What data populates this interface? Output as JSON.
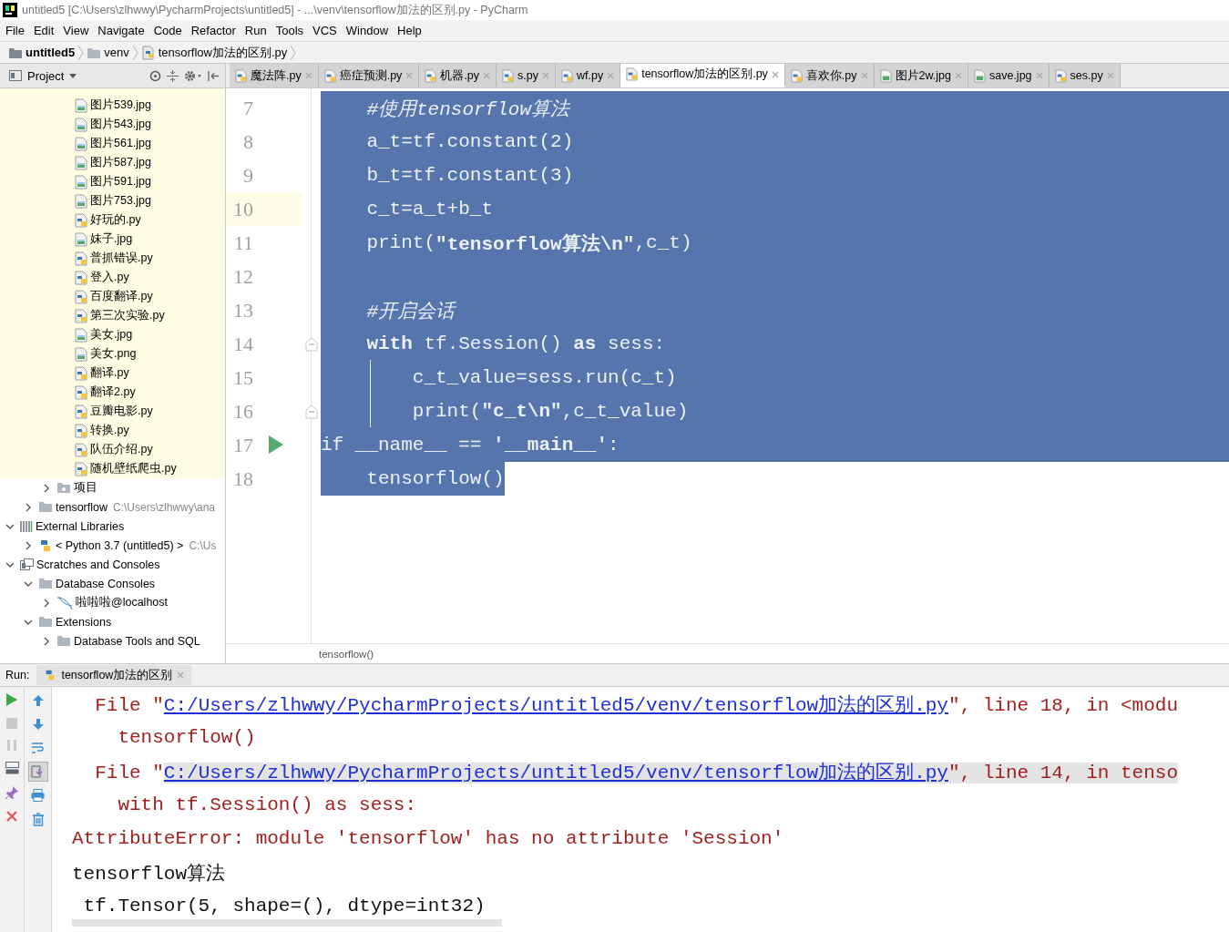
{
  "window": {
    "title": "untitled5 [C:\\Users\\zlhwwy\\PycharmProjects\\untitled5] - ...\\venv\\tensorflow加法的区别.py - PyCharm"
  },
  "menu": [
    "File",
    "Edit",
    "View",
    "Navigate",
    "Code",
    "Refactor",
    "Run",
    "Tools",
    "VCS",
    "Window",
    "Help"
  ],
  "breadcrumbs": [
    {
      "label": "untitled5",
      "kind": "project"
    },
    {
      "label": "venv",
      "kind": "folder"
    },
    {
      "label": "tensorflow加法的区别.py",
      "kind": "python"
    }
  ],
  "project_panel": {
    "title": "Project",
    "tree": [
      {
        "children": [
          {
            "children": [
              {
                "children": [
                  {
                    "label": "图片539.jpg",
                    "kind": "image"
                  },
                  {
                    "label": "图片543.jpg",
                    "kind": "image"
                  },
                  {
                    "label": "图片561.jpg",
                    "kind": "image"
                  },
                  {
                    "label": "图片587.jpg",
                    "kind": "image"
                  },
                  {
                    "label": "图片591.jpg",
                    "kind": "image"
                  },
                  {
                    "label": "图片753.jpg",
                    "kind": "image"
                  },
                  {
                    "label": "好玩的.py",
                    "kind": "python"
                  },
                  {
                    "label": "妹子.jpg",
                    "kind": "image"
                  },
                  {
                    "label": "普抓错误.py",
                    "kind": "python"
                  },
                  {
                    "label": "登入.py",
                    "kind": "python"
                  },
                  {
                    "label": "百度翻译.py",
                    "kind": "python"
                  },
                  {
                    "label": "第三次实验.py",
                    "kind": "python"
                  },
                  {
                    "label": "美女.jpg",
                    "kind": "image"
                  },
                  {
                    "label": "美女.png",
                    "kind": "image"
                  },
                  {
                    "label": "翻译.py",
                    "kind": "python"
                  },
                  {
                    "label": "翻译2.py",
                    "kind": "python"
                  },
                  {
                    "label": "豆瓣电影.py",
                    "kind": "python"
                  },
                  {
                    "label": "转换.py",
                    "kind": "python"
                  },
                  {
                    "label": "队伍介绍.py",
                    "kind": "python"
                  },
                  {
                    "label": "随机壁纸爬虫.py",
                    "kind": "python"
                  }
                ]
              },
              {
                "label": "项目",
                "kind": "package",
                "expanded": false
              }
            ]
          },
          {
            "label": "tensorflow",
            "detail": "C:\\Users\\zlhwwy\\ana",
            "kind": "folder",
            "expanded": false
          }
        ]
      },
      {
        "label": "External Libraries",
        "kind": "library",
        "expanded": true,
        "children": [
          {
            "label": "< Python 3.7 (untitled5) >",
            "detail": "C:\\Us",
            "kind": "sdk",
            "expanded": false
          }
        ]
      },
      {
        "label": "Scratches and Consoles",
        "kind": "scratches",
        "expanded": true,
        "children": [
          {
            "label": "Database Consoles",
            "kind": "folder",
            "expanded": true,
            "children": [
              {
                "label": "啦啦啦@localhost",
                "kind": "database",
                "expanded": false
              }
            ]
          },
          {
            "label": "Extensions",
            "kind": "folder",
            "expanded": true,
            "children": [
              {
                "label": "Database Tools and SQL",
                "kind": "folder",
                "expanded": false
              }
            ]
          }
        ]
      }
    ]
  },
  "editor_tabs": [
    {
      "label": "魔法阵.py",
      "kind": "python",
      "selected": false
    },
    {
      "label": "癌症预测.py",
      "kind": "python",
      "selected": false
    },
    {
      "label": "机器.py",
      "kind": "python",
      "selected": false
    },
    {
      "label": "s.py",
      "kind": "python",
      "selected": false
    },
    {
      "label": "wf.py",
      "kind": "python",
      "selected": false
    },
    {
      "label": "tensorflow加法的区别.py",
      "kind": "python",
      "selected": true
    },
    {
      "label": "喜欢你.py",
      "kind": "python",
      "selected": false
    },
    {
      "label": "图片2w.jpg",
      "kind": "image",
      "selected": false
    },
    {
      "label": "save.jpg",
      "kind": "image",
      "selected": false
    },
    {
      "label": "ses.py",
      "kind": "python",
      "selected": false
    }
  ],
  "code_lines": [
    {
      "number": "7",
      "caret": false,
      "selected": true,
      "tokens": [
        {
          "t": "    #使用tensorflow算法",
          "kind": "comment"
        }
      ]
    },
    {
      "number": "8",
      "caret": false,
      "selected": true,
      "tokens": [
        {
          "t": "    a_t=tf.constant(2)",
          "kind": "plain"
        }
      ]
    },
    {
      "number": "9",
      "caret": false,
      "selected": true,
      "tokens": [
        {
          "t": "    b_t=tf.constant(3)",
          "kind": "plain"
        }
      ]
    },
    {
      "number": "10",
      "caret": true,
      "selected": true,
      "tokens": [
        {
          "t": "    c_t=a_t+b_t",
          "kind": "plain"
        }
      ]
    },
    {
      "number": "11",
      "caret": false,
      "selected": true,
      "tokens": [
        {
          "t": "    print(",
          "kind": "plain"
        },
        {
          "t": "\"tensorflow算法\\n\"",
          "kind": "string"
        },
        {
          "t": ",c_t)",
          "kind": "plain"
        }
      ]
    },
    {
      "number": "12",
      "caret": false,
      "selected": true
    },
    {
      "number": "13",
      "caret": false,
      "selected": true,
      "tokens": [
        {
          "t": "    #开启会话",
          "kind": "comment"
        }
      ]
    },
    {
      "number": "14",
      "caret": false,
      "fold": true,
      "selected": true,
      "tokens": [
        {
          "t": "    with",
          "kind": "keyword"
        },
        {
          "t": " tf.Session() ",
          "kind": "plain"
        },
        {
          "t": "as",
          "kind": "keyword"
        },
        {
          "t": " sess:",
          "kind": "plain"
        }
      ]
    },
    {
      "number": "15",
      "caret": false,
      "selected": true,
      "tokens": [
        {
          "t": "        c_t_value=sess.run(c_t)",
          "kind": "plain"
        }
      ]
    },
    {
      "number": "16",
      "caret": false,
      "fold": true,
      "selected": true,
      "tokens": [
        {
          "t": "        print(",
          "kind": "plain"
        },
        {
          "t": "\"c_t\\n\"",
          "kind": "string"
        },
        {
          "t": ",c_t_value)",
          "kind": "plain"
        }
      ]
    },
    {
      "number": "17",
      "caret": false,
      "run_marker": true,
      "selected": true,
      "tokens": [
        {
          "t": "if __name__ == ",
          "kind": "plain"
        },
        {
          "t": "'__main__'",
          "kind": "string"
        },
        {
          "t": ":",
          "kind": "plain"
        }
      ]
    },
    {
      "number": "18",
      "caret": false,
      "selected": true,
      "tokens": [
        {
          "t": "    tensorflow()",
          "kind": "plain"
        }
      ]
    }
  ],
  "editor_breadcrumb": "tensorflow()",
  "run_panel": {
    "label": "Run:",
    "tab": "tensorflow加法的区别",
    "toolbar": [
      {
        "kind": "up",
        "on": false
      },
      {
        "kind": "down",
        "on": false
      },
      {
        "kind": "wrap",
        "on": false
      },
      {
        "kind": "scroll_end",
        "on": true
      },
      {
        "kind": "print",
        "on": false
      },
      {
        "kind": "trash",
        "on": false
      }
    ],
    "console": [
      {
        "kind": "error",
        "highlighted": false,
        "segments": [
          {
            "t": "  File \"",
            "kind": "text"
          },
          {
            "t": "C:/Users/zlhwwy/PycharmProjects/untitled5/venv/tensorflow加法的区别.py",
            "kind": "link"
          },
          {
            "t": "\", line 18, in <modu",
            "kind": "text"
          }
        ]
      },
      {
        "kind": "error",
        "highlighted": false,
        "segments": [
          {
            "t": "    tensorflow()",
            "kind": "text"
          }
        ]
      },
      {
        "kind": "error",
        "highlighted": true,
        "segments": [
          {
            "t": "  File \"",
            "kind": "text"
          },
          {
            "t": "C:/Users/zlhwwy/PycharmProjects/untitled5/venv/tensorflow加法的区别.py",
            "kind": "link"
          },
          {
            "t": "\", line 14, in tenso",
            "kind": "text"
          }
        ]
      },
      {
        "kind": "error",
        "highlighted": false,
        "segments": [
          {
            "t": "    with tf.Session() as sess:",
            "kind": "text"
          }
        ]
      },
      {
        "kind": "error",
        "highlighted": false,
        "segments": [
          {
            "t": "AttributeError: module 'tensorflow' has no attribute 'Session'",
            "kind": "text"
          }
        ]
      },
      {
        "kind": "output",
        "highlighted": false,
        "segments": [
          {
            "t": "tensorflow算法",
            "kind": "text"
          }
        ]
      },
      {
        "kind": "output",
        "highlighted": false,
        "segments": [
          {
            "t": " tf.Tensor(5, shape=(), dtype=int32)",
            "kind": "text"
          }
        ]
      }
    ]
  }
}
